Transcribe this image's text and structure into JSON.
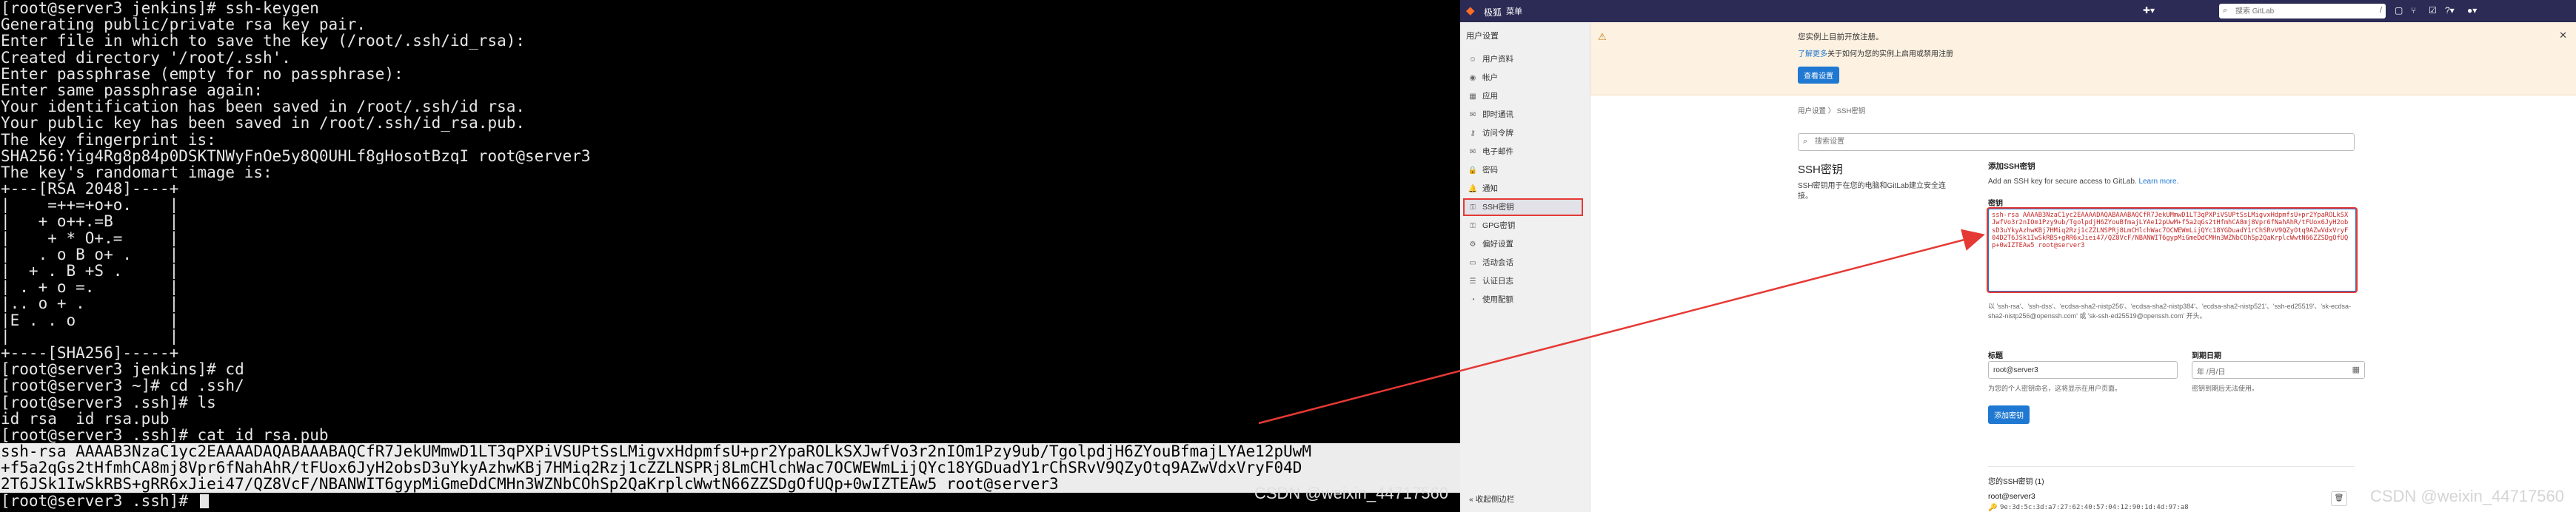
{
  "terminal": {
    "lines": [
      "[root@server3 jenkins]# ssh-keygen",
      "Generating public/private rsa key pair.",
      "Enter file in which to save the key (/root/.ssh/id_rsa):",
      "Created directory '/root/.ssh'.",
      "Enter passphrase (empty for no passphrase):",
      "Enter same passphrase again:",
      "Your identification has been saved in /root/.ssh/id_rsa.",
      "Your public key has been saved in /root/.ssh/id_rsa.pub.",
      "The key fingerprint is:",
      "SHA256:Yig4Rg8p84p0DSKTNWyFnOe5y8Q0UHLf8gHosotBzqI root@server3",
      "The key's randomart image is:",
      "+---[RSA 2048]----+",
      "|    =++=+o+o.    |",
      "|   + o++.=B      |",
      "|    + * O+.=     |",
      "|   . o B o+ .    |",
      "|  + . B +S .     |",
      "| . + o =.        |",
      "|.. o + .         |",
      "|E . . o          |",
      "|                 |",
      "+----[SHA256]-----+",
      "[root@server3 jenkins]# cd",
      "[root@server3 ~]# cd .ssh/",
      "[root@server3 .ssh]# ls",
      "id_rsa  id_rsa.pub",
      "[root@server3 .ssh]# cat id_rsa.pub",
      "ssh-rsa AAAAB3NzaC1yc2EAAAADAQABAAABAQCfR7JekUMmwD1LT3qPXPiVSUPtSsLMigvxHdpmfsU+pr2YpaROLkSXJwfVo3r2nIOm1Pzy9ub/TgolpdjH6ZYouBfmajLYAe12pUwM",
      "+f5a2qGs2tHfmhCA8mj8Vpr6fNahAhR/tFUox6JyH2obsD3uYkyAzhwKBj7HMiq2Rzj1cZZLNSPRj8LmCHlchWac7OCWEWmLijQYc18YGDuadY1rChSRvV9QZyOtq9AZwVdxVryF04D",
      "2T6JSk1IwSkRBS+gRR6xJiei47/QZ8VcF/NBANWIT6gypMiGmeDdCMHn3WZNbCOhSp2QaKrplcWwtN66ZZSDgOfUQp+0wIZTEAw5 root@server3",
      "[root@server3 .ssh]# "
    ],
    "watermark": "CSDN @weixin_44717560"
  },
  "gitlab": {
    "topbar": {
      "brand": "极狐",
      "menu": "菜单",
      "search_placeholder": "搜索 GitLab"
    },
    "sidebar": {
      "header": "用户设置",
      "items": [
        {
          "label": "用户资料",
          "icon": "user-icon"
        },
        {
          "label": "帐户",
          "icon": "account-icon"
        },
        {
          "label": "应用",
          "icon": "applications-icon"
        },
        {
          "label": "即时通讯",
          "icon": "chat-icon"
        },
        {
          "label": "访问令牌",
          "icon": "token-icon"
        },
        {
          "label": "电子邮件",
          "icon": "email-icon"
        },
        {
          "label": "密码",
          "icon": "lock-icon"
        },
        {
          "label": "通知",
          "icon": "bell-icon"
        },
        {
          "label": "SSH密钥",
          "icon": "key-icon"
        },
        {
          "label": "GPG密钥",
          "icon": "key-icon"
        },
        {
          "label": "偏好设置",
          "icon": "preferences-icon"
        },
        {
          "label": "活动会话",
          "icon": "monitor-icon"
        },
        {
          "label": "认证日志",
          "icon": "log-icon"
        },
        {
          "label": "使用配额",
          "icon": "usage-icon"
        }
      ],
      "active_index": 8,
      "collapse": "收起侧边栏"
    },
    "banner": {
      "title": "您实例上目前开放注册。",
      "text_link": "了解更多",
      "text_rest": "关于如何为您的实例上启用或禁用注册",
      "button": "查看设置"
    },
    "breadcrumb": "用户设置 〉 SSH密钥",
    "search_settings_placeholder": "搜索设置",
    "section": {
      "title": "SSH密钥",
      "description": "SSH密钥用于在您的电脑和GitLab建立安全连接。"
    },
    "add_key": {
      "title": "添加SSH密钥",
      "desc": "Add an SSH key for secure access to GitLab.",
      "learn_more": "Learn more.",
      "key_label": "密钥",
      "key_value": "ssh-rsa AAAAB3NzaC1yc2EAAAADAQABAAABAQCfR7JekUMmwD1LT3qPXPiVSUPtSsLMigvxHdpmfsU+pr2YpaROLkSXJwfVo3r2nIOm1Pzy9ub/TgolpdjH6ZYouBfmajLYAe12pUwM+f5a2qGs2tHfmhCA8mj8Vpr6fNahAhR/tFUox6JyH2obsD3uYkyAzhwKBj7HMiq2Rzj1cZZLNSPRj8LmCHlchWac7OCWEWmLijQYc18YGDuadY1rChSRvV9QZyOtq9AZwVdxVryF04D2T6JSk1IwSkRBS+gRR6xJiei47/QZ8VcF/NBANWIT6gypMiGmeDdCMHn3WZNbCOhSp2QaKrplcWwtN66ZZSDgOfUQp+0wIZTEAw5 root@server3",
      "key_help": "以 'ssh-rsa'、'ssh-dss'、'ecdsa-sha2-nistp256'、'ecdsa-sha2-nistp384'、'ecdsa-sha2-nistp521'、'ssh-ed25519'、'sk-ecdsa-sha2-nistp256@openssh.com' 或 'sk-ssh-ed25519@openssh.com' 开头。",
      "title_label": "标题",
      "title_value": "root@server3",
      "title_help": "为您的个人密钥命名，这将显示在用户页面。",
      "expires_label": "到期日期",
      "expires_value": "年 /月/日",
      "expires_help": "密钥到期后无法使用。",
      "submit": "添加密钥"
    },
    "your_keys": {
      "title": "您的SSH密钥 (1)",
      "name": "root@server3",
      "fingerprint": "9e:3d:5c:3d:a7:27:62:40:57:04:12:90:1d:4d:97:a8"
    },
    "watermark": "CSDN @weixin_44717560"
  },
  "colors": {
    "highlight": "#e53935",
    "topbar": "#2b2b55",
    "link": "#1f78d1"
  }
}
